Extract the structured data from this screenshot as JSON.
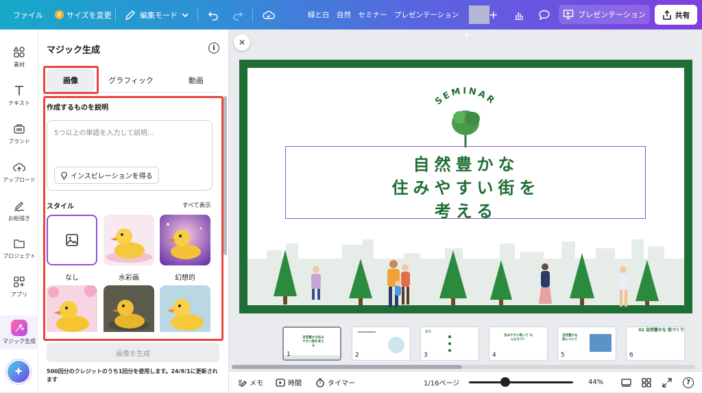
{
  "topbar": {
    "file": "ファイル",
    "resize": "サイズを変更",
    "edit_mode": "編集モード",
    "doc_title": "緑と白　自然　セミナー　プレゼンテーション",
    "present": "プレゼンテーション",
    "share": "共有",
    "plus": "+"
  },
  "rail": {
    "items": [
      {
        "label": "素材",
        "icon": "elements-icon"
      },
      {
        "label": "テキスト",
        "icon": "text-icon"
      },
      {
        "label": "ブランド",
        "icon": "brand-icon"
      },
      {
        "label": "アップロード",
        "icon": "upload-icon"
      },
      {
        "label": "お絵描き",
        "icon": "draw-icon"
      },
      {
        "label": "プロジェクト",
        "icon": "folder-icon"
      },
      {
        "label": "アプリ",
        "icon": "apps-icon"
      },
      {
        "label": "マジック生成",
        "icon": "magic-icon"
      }
    ]
  },
  "panel": {
    "title": "マジック生成",
    "tabs": [
      "画像",
      "グラフィック",
      "動画"
    ],
    "active_tab": "画像",
    "describe_label": "作成するものを説明",
    "placeholder": "5つ以上の単語を入力して説明...",
    "inspire": "インスピレーションを得る",
    "style_label": "スタイル",
    "see_all": "すべて表示",
    "styles": [
      {
        "name": "なし",
        "selected": true
      },
      {
        "name": "水彩画",
        "selected": false
      },
      {
        "name": "幻想的",
        "selected": false
      }
    ],
    "generate": "画像を生成",
    "credits": "500回分のクレジットのうち1回分を使用します。24/9/1に更新されます"
  },
  "slide": {
    "seminar": "SEMINAR",
    "title_lines": [
      "自然豊かな",
      "住みやすい街を",
      "考える"
    ]
  },
  "filmstrip": {
    "thumbs": [
      {
        "num": "1",
        "text": "自然豊かな住みやすい街を考える",
        "active": true
      },
      {
        "num": "2",
        "text": "",
        "active": false
      },
      {
        "num": "3",
        "text": "目次",
        "active": false
      },
      {
        "num": "4",
        "text": "住みやすい街って なんだろう？",
        "active": false
      },
      {
        "num": "5",
        "text": "自然豊かな街について",
        "active": false
      },
      {
        "num": "6",
        "text": "02 自然豊かな 街づくり",
        "active": false
      }
    ]
  },
  "bottombar": {
    "notes": "メモ",
    "timer_duration": "時間",
    "timer": "タイマー",
    "page": "1/16ページ",
    "zoom": "44%",
    "zoom_level": 0.44
  },
  "colors": {
    "slide_green": "#1f6e35",
    "selection_purple": "#8a4fd6",
    "highlight_red": "#e8453c"
  }
}
